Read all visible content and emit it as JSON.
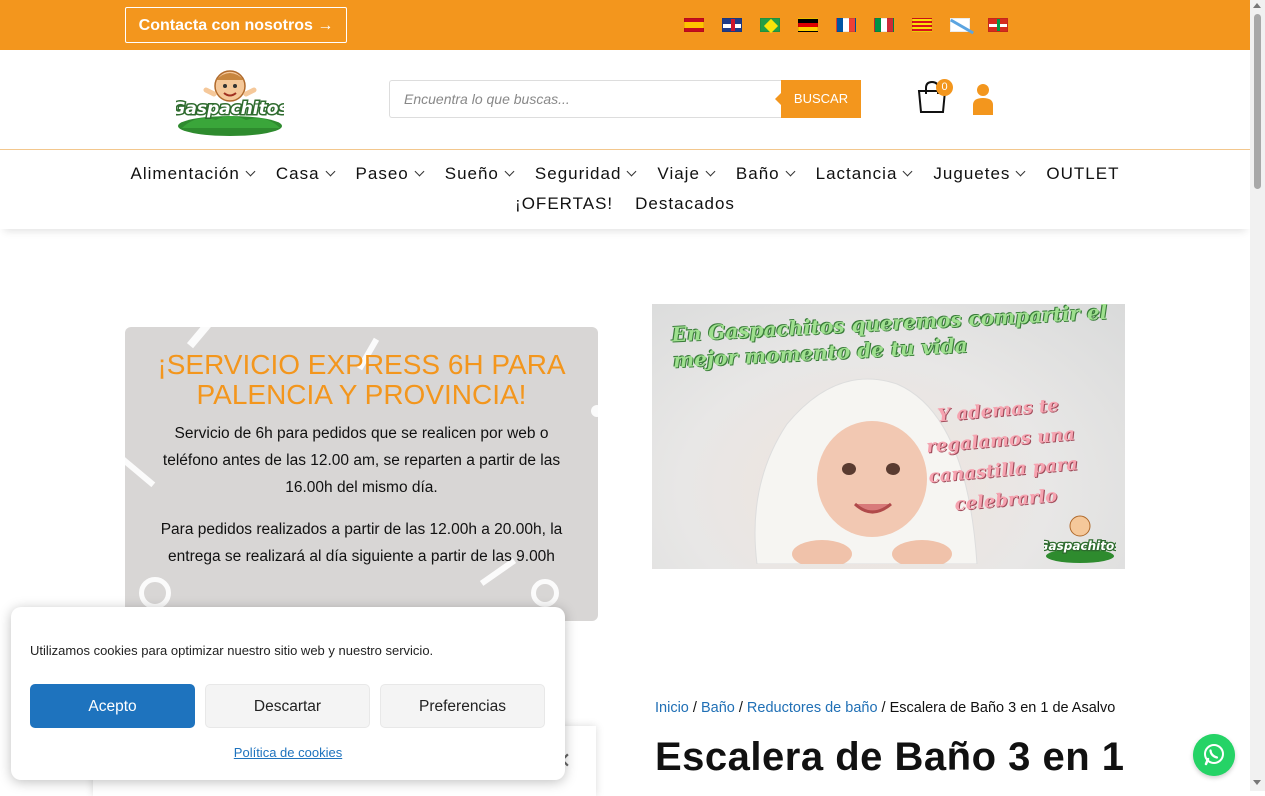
{
  "topbar": {
    "contact_label": "Contacta con nosotros →",
    "flags": [
      "es-flag-icon",
      "uk-flag-icon",
      "br-flag-icon",
      "de-flag-icon",
      "fr-flag-icon",
      "it-flag-icon",
      "ca-flag-icon",
      "gl-flag-icon",
      "eu-flag-icon"
    ],
    "color": "#f3961d"
  },
  "header": {
    "logo_text": "Gaspachitos",
    "search_placeholder": "Encuentra lo que buscas...",
    "search_button": "BUSCAR",
    "cart_count": "0"
  },
  "nav": {
    "row1": [
      {
        "label": "Alimentación",
        "dropdown": true
      },
      {
        "label": "Casa",
        "dropdown": true
      },
      {
        "label": "Paseo",
        "dropdown": true
      },
      {
        "label": "Sueño",
        "dropdown": true
      },
      {
        "label": "Seguridad",
        "dropdown": true
      },
      {
        "label": "Viaje",
        "dropdown": true
      },
      {
        "label": "Baño",
        "dropdown": true
      },
      {
        "label": "Lactancia",
        "dropdown": true
      },
      {
        "label": "Juguetes",
        "dropdown": true
      },
      {
        "label": "OUTLET",
        "dropdown": false
      }
    ],
    "row2": [
      {
        "label": "¡OFERTAS!",
        "dropdown": false
      },
      {
        "label": "Destacados",
        "dropdown": false
      }
    ]
  },
  "service": {
    "title": "¡SERVICIO EXPRESS 6H PARA PALENCIA Y PROVINCIA!",
    "p1": "Servicio de 6h para pedidos que se realicen por web o teléfono antes de las 12.00 am, se reparten a partir de las 16.00h del mismo día.",
    "p2": "Para pedidos realizados a partir de las 12.00h a 20.00h, la entrega se realizará al día siguiente a partir de las 9.00h"
  },
  "banner": {
    "line1": "En Gaspachitos queremos compartir el mejor momento de tu vida",
    "line2": "Y ademas te regalamos una canastilla para celebrarlo",
    "logo_text": "Gaspachitos"
  },
  "breadcrumb": {
    "items": [
      "Inicio",
      "Baño",
      "Reductores de baño"
    ],
    "current": "Escalera de Baño 3 en 1 de Asalvo",
    "separator": " / "
  },
  "product": {
    "title": "Escalera de Baño 3 en 1"
  },
  "cookie": {
    "text": "Utilizamos cookies para optimizar nuestro sitio web y nuestro servicio.",
    "accept": "Acepto",
    "deny": "Descartar",
    "prefs": "Preferencias",
    "policy": "Política de cookies"
  }
}
